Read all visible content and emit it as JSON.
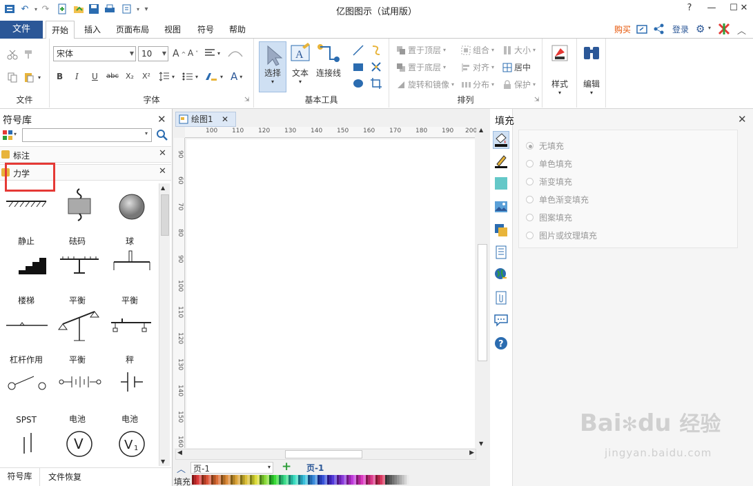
{
  "window": {
    "title": "亿图图示（试用版）"
  },
  "tabs": {
    "file": "文件",
    "items": [
      "开始",
      "插入",
      "页面布局",
      "视图",
      "符号",
      "帮助"
    ]
  },
  "header_right": {
    "buy": "购买",
    "login": "登录"
  },
  "ribbon": {
    "file_group": "文件",
    "font_name": "宋体",
    "font_size": "10",
    "font_group": "字体",
    "bold": "B",
    "italic": "I",
    "underline": "U",
    "strike": "abc",
    "sub": "X₂",
    "sup": "X²",
    "select": "选择",
    "text": "文本",
    "connector": "连接线",
    "basic_tools": "基本工具",
    "bring_front": "置于顶层",
    "send_back": "置于底层",
    "rotate_mirror": "旋转和镜像",
    "group": "组合",
    "align": "对齐",
    "distribute": "分布",
    "size": "大小",
    "center": "居中",
    "protect": "保护",
    "arrange": "排列",
    "style": "样式",
    "edit": "编辑"
  },
  "left_panel": {
    "title": "符号库",
    "search_placeholder": "",
    "lib1": "标注",
    "lib2": "力学",
    "symbols": [
      "静止",
      "砝码",
      "球",
      "楼梯",
      "平衡",
      "平衡",
      "杠杆作用",
      "平衡",
      "秤",
      "SPST",
      "电池",
      "电池",
      "",
      "",
      ""
    ],
    "bottom_tabs": [
      "符号库",
      "文件恢复"
    ]
  },
  "canvas": {
    "doc_tab": "绘图1",
    "ruler_h": [
      "100",
      "110",
      "120",
      "130",
      "140",
      "150",
      "160",
      "170",
      "180",
      "190",
      "200"
    ],
    "ruler_v": [
      "90",
      "60",
      "70",
      "80",
      "90",
      "100",
      "110",
      "120",
      "130",
      "140",
      "150",
      "160"
    ],
    "page_select": "页-1",
    "page_tab": "页-1",
    "fill_label": "填充"
  },
  "right_panel": {
    "title": "填充",
    "options": [
      "无填充",
      "单色填充",
      "渐变填充",
      "单色渐变填充",
      "图案填充",
      "图片或纹理填充"
    ],
    "selected": 0
  },
  "watermark": {
    "text1": "Bai",
    "text2": "du",
    "text3": "经验",
    "url": "jingyan.baidu.com"
  },
  "colors": {
    "accent": "#2b5797",
    "highlight": "#e53935",
    "buy": "#e65100"
  }
}
